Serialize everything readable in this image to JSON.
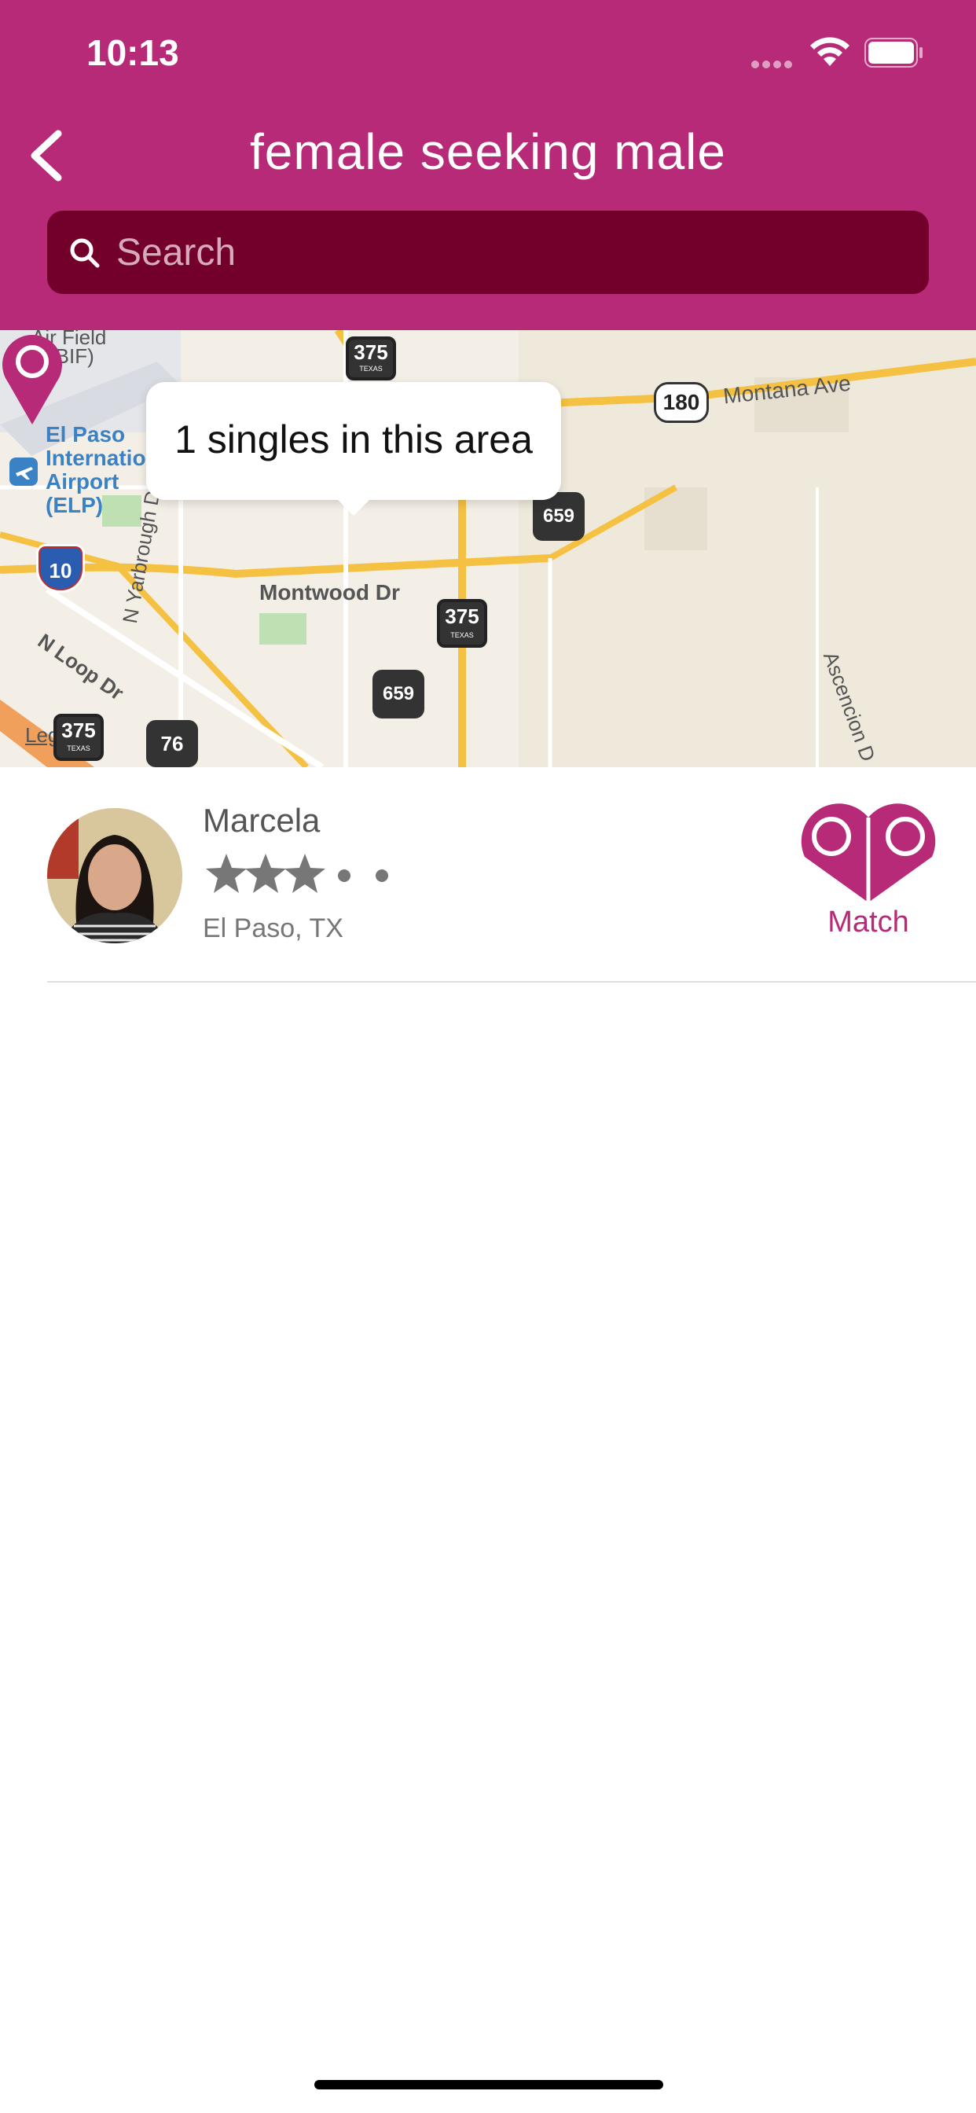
{
  "status_bar": {
    "time": "10:13"
  },
  "header": {
    "title": "female seeking male"
  },
  "search": {
    "placeholder": "Search"
  },
  "map": {
    "callout": "1 singles in this area",
    "labels": {
      "airfield": "Air Field",
      "bif": "(BIF)",
      "airport_1": "El Paso",
      "airport_2": "Internatio",
      "airport_3": "Airport",
      "airport_4": "(ELP)",
      "montana_ave": "Montana Ave",
      "montwood": "Montwood Dr",
      "n_yarbrough": "N Yarbrough Dr",
      "n_loop": "N Loop Dr",
      "ascencion": "Ascencion D",
      "legal": "Legal"
    },
    "shields": {
      "r375_top": "375",
      "r180": "180",
      "r659_top": "659",
      "r375_mid": "375",
      "r659_bottom": "659",
      "r375_left": "375",
      "r76": "76",
      "i10": "10",
      "texas": "TEXAS"
    }
  },
  "results": [
    {
      "name": "Marcela",
      "rating": 3,
      "rating_max": 5,
      "location": "El Paso, TX",
      "action": "Match"
    }
  ],
  "colors": {
    "brand": "#b72a78",
    "search_bg": "#73002b"
  }
}
